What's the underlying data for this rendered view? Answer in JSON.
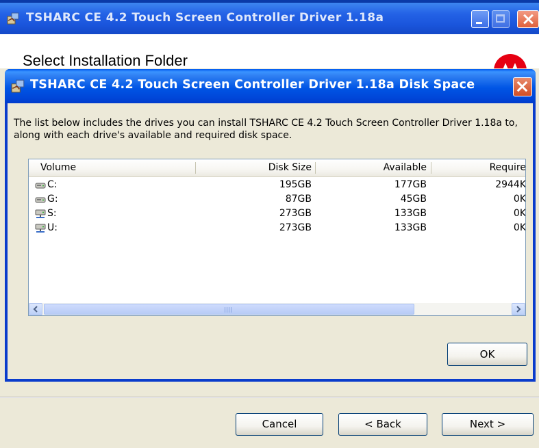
{
  "outer": {
    "title": "TSHARC CE 4.2 Touch Screen Controller Driver 1.18a",
    "heading": "Select Installation Folder",
    "buttons": {
      "cancel": "Cancel",
      "back": "< Back",
      "next": "Next >"
    }
  },
  "dialog": {
    "title": "TSHARC CE 4.2 Touch Screen Controller Driver 1.18a Disk Space",
    "description": "The list below includes the drives you can install TSHARC CE 4.2 Touch Screen Controller Driver 1.18a to, along with each drive's available and required disk space.",
    "columns": {
      "volume": "Volume",
      "disk_size": "Disk Size",
      "available": "Available",
      "required": "Require"
    },
    "rows": [
      {
        "icon": "local-drive-icon",
        "volume": "C:",
        "disk_size": "195GB",
        "available": "177GB",
        "required": "2944K"
      },
      {
        "icon": "local-drive-icon",
        "volume": "G:",
        "disk_size": "87GB",
        "available": "45GB",
        "required": "0K"
      },
      {
        "icon": "network-drive-icon",
        "volume": "S:",
        "disk_size": "273GB",
        "available": "133GB",
        "required": "0K"
      },
      {
        "icon": "network-drive-icon",
        "volume": "U:",
        "disk_size": "273GB",
        "available": "133GB",
        "required": "0K"
      }
    ],
    "ok_label": "OK"
  },
  "colors": {
    "titlebar_blue": "#0054e3",
    "dialog_face": "#ece9d8",
    "close_red": "#e0603c",
    "logo_red": "#e60012"
  }
}
